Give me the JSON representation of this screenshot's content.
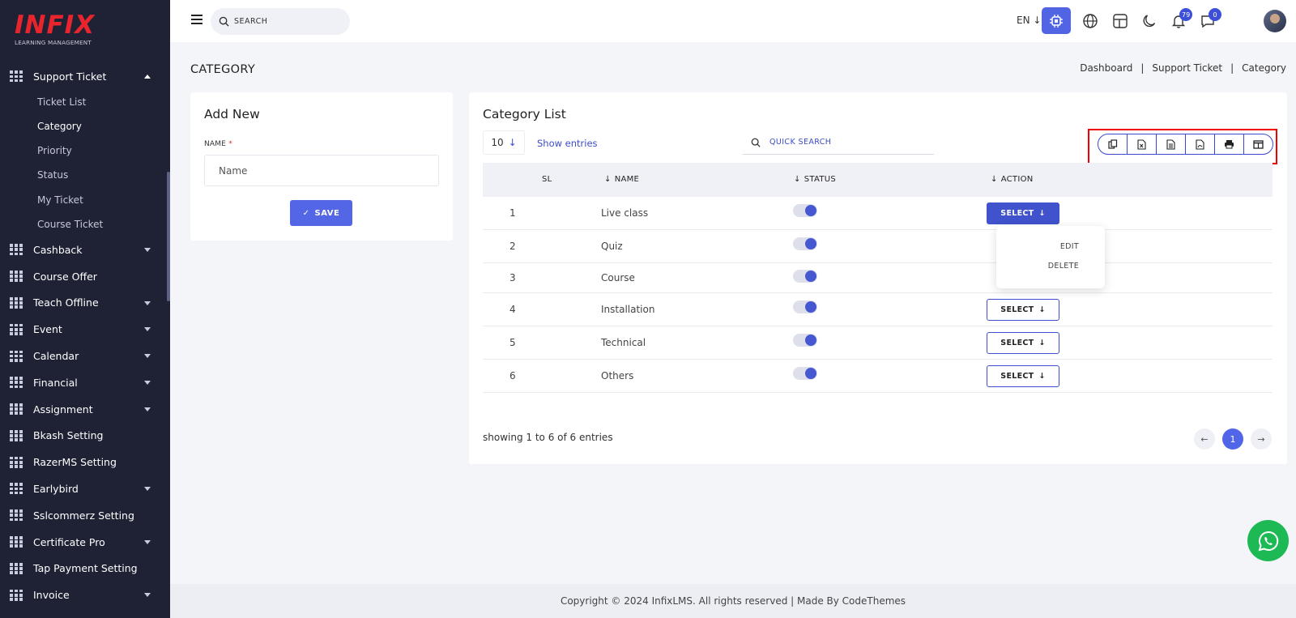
{
  "brand": {
    "logo_text": "INFIX",
    "logo_sub": "LEARNING MANAGEMENT",
    "accent": "#5366e6",
    "logo_color": "#e8252d"
  },
  "sidebar": {
    "items": [
      {
        "label": "Support Ticket",
        "icon": "grid-icon",
        "expanded": true,
        "children": [
          "Ticket List",
          "Category",
          "Priority",
          "Status",
          "My Ticket",
          "Course Ticket"
        ]
      },
      {
        "label": "Cashback",
        "icon": "grid-icon",
        "has_caret": true
      },
      {
        "label": "Course Offer",
        "icon": "grid-icon",
        "has_caret": false
      },
      {
        "label": "Teach Offline",
        "icon": "grid-icon",
        "has_caret": true
      },
      {
        "label": "Event",
        "icon": "grid-icon",
        "has_caret": true
      },
      {
        "label": "Calendar",
        "icon": "grid-icon",
        "has_caret": true
      },
      {
        "label": "Financial",
        "icon": "grid-icon",
        "has_caret": true
      },
      {
        "label": "Assignment",
        "icon": "grid-icon",
        "has_caret": true
      },
      {
        "label": "Bkash Setting",
        "icon": "grid-icon",
        "has_caret": false
      },
      {
        "label": "RazerMS Setting",
        "icon": "grid-icon",
        "has_caret": false
      },
      {
        "label": "Earlybird",
        "icon": "grid-icon",
        "has_caret": true
      },
      {
        "label": "Sslcommerz Setting",
        "icon": "grid-icon",
        "has_caret": false
      },
      {
        "label": "Certificate Pro",
        "icon": "grid-icon",
        "has_caret": true
      },
      {
        "label": "Tap Payment Setting",
        "icon": "grid-icon",
        "has_caret": false
      },
      {
        "label": "Invoice",
        "icon": "grid-icon",
        "has_caret": true
      }
    ],
    "active_child": "Category"
  },
  "topbar": {
    "search_placeholder": "SEARCH",
    "lang": "EN",
    "notifications_count": "79",
    "messages_count": "0"
  },
  "page": {
    "title": "CATEGORY",
    "breadcrumb": [
      "Dashboard",
      "Support Ticket",
      "Category"
    ]
  },
  "add_new": {
    "title": "Add New",
    "name_label": "NAME",
    "required_mark": "*",
    "name_placeholder": "Name",
    "save_label": "SAVE"
  },
  "list": {
    "title": "Category List",
    "entries_value": "10",
    "show_entries": "Show entries",
    "quick_search": "QUICK SEARCH",
    "columns": {
      "sl": "SL",
      "name": "NAME",
      "status": "STATUS",
      "action": "ACTION"
    },
    "rows": [
      {
        "sl": "1",
        "name": "Live class",
        "status": true
      },
      {
        "sl": "2",
        "name": "Quiz",
        "status": true
      },
      {
        "sl": "3",
        "name": "Course",
        "status": true
      },
      {
        "sl": "4",
        "name": "Installation",
        "status": true
      },
      {
        "sl": "5",
        "name": "Technical",
        "status": true
      },
      {
        "sl": "6",
        "name": "Others",
        "status": true
      }
    ],
    "select_label": "SELECT",
    "dropdown": {
      "edit": "EDIT",
      "delete": "DELETE"
    },
    "showing": "showing 1 to 6 of 6 entries",
    "current_page": "1"
  },
  "footer": {
    "text": "Copyright © 2024 InfixLMS. All rights reserved | Made By CodeThemes"
  }
}
